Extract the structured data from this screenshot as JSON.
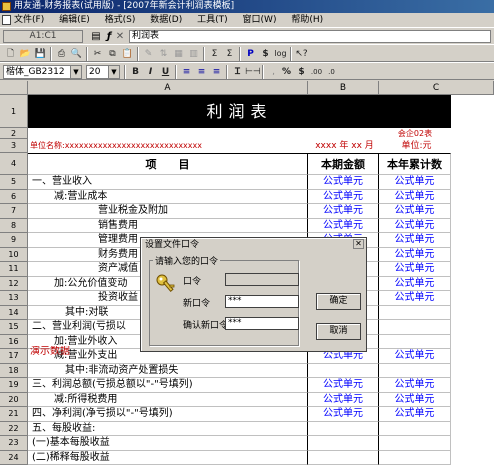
{
  "window": {
    "title": "用友通-财务报表(试用版) - [2007年新会计利润表模板]"
  },
  "menu": [
    "文件(F)",
    "编辑(E)",
    "格式(S)",
    "数据(D)",
    "工具(T)",
    "窗口(W)",
    "帮助(H)"
  ],
  "formula_bar": {
    "cell_ref": "A1:C1",
    "value": "利润表"
  },
  "format_toolbar": {
    "font": "楷体_GB2312",
    "size": "20"
  },
  "sheet": {
    "columns": [
      "A",
      "B",
      "C"
    ],
    "title": "利润表",
    "form_code": "会企02表",
    "company_label": "单位名称:xxxxxxxxxxxxxxxxxxxxxxxxxxxxx",
    "period": "xxxx 年 xx 月",
    "unit": "单位:元",
    "headers": [
      "项　　目",
      "本期金额",
      "本年累计数"
    ],
    "rows": [
      {
        "num": "5",
        "a": "一、营业收入",
        "indent": 0,
        "f": true
      },
      {
        "num": "6",
        "a": "减:营业成本",
        "indent": 2,
        "f": true
      },
      {
        "num": "7",
        "a": "营业税金及附加",
        "indent": 6,
        "f": true
      },
      {
        "num": "8",
        "a": "销售费用",
        "indent": 6,
        "f": true
      },
      {
        "num": "9",
        "a": "管理费用",
        "indent": 6,
        "f": true
      },
      {
        "num": "10",
        "a": "财务费用",
        "indent": 6,
        "f": true
      },
      {
        "num": "11",
        "a": "资产减值",
        "indent": 6,
        "f": true
      },
      {
        "num": "12",
        "a": "加:公允价值变动",
        "indent": 2,
        "f": true
      },
      {
        "num": "13",
        "a": "投资收益",
        "indent": 6,
        "f": true
      },
      {
        "num": "14",
        "a": "其中:对联",
        "indent": 3,
        "f": false
      },
      {
        "num": "15",
        "a": "二、营业利润(亏损以",
        "indent": 0,
        "f": false
      },
      {
        "num": "16",
        "a": "加:营业外收入",
        "indent": 2,
        "f": false
      },
      {
        "num": "17",
        "a": "减:营业外支出",
        "indent": 2,
        "f": true
      },
      {
        "num": "18",
        "a": "其中:非流动资产处置损失",
        "indent": 3,
        "f": false
      },
      {
        "num": "19",
        "a": "三、利润总额(亏损总额以\"-\"号填列)",
        "indent": 0,
        "f": true
      },
      {
        "num": "20",
        "a": "减:所得税费用",
        "indent": 2,
        "f": true
      },
      {
        "num": "21",
        "a": "四、净利润(净亏损以\"-\"号填列)",
        "indent": 0,
        "f": true
      },
      {
        "num": "22",
        "a": "五、每股收益:",
        "indent": 0,
        "f": false
      },
      {
        "num": "23",
        "a": "(一)基本每股收益",
        "indent": 0,
        "f": false
      },
      {
        "num": "24",
        "a": "(二)稀释每股收益",
        "indent": 0,
        "f": false
      }
    ],
    "formula_text": "公式单元",
    "demo_tag": "演示数据"
  },
  "dialog": {
    "title": "设置文件口令",
    "group_label": "请输入您的口令",
    "old_label": "口令",
    "new_label": "新口令",
    "confirm_label": "确认新口令",
    "new_value": "***",
    "confirm_value": "***",
    "ok": "确定",
    "cancel": "取消"
  }
}
